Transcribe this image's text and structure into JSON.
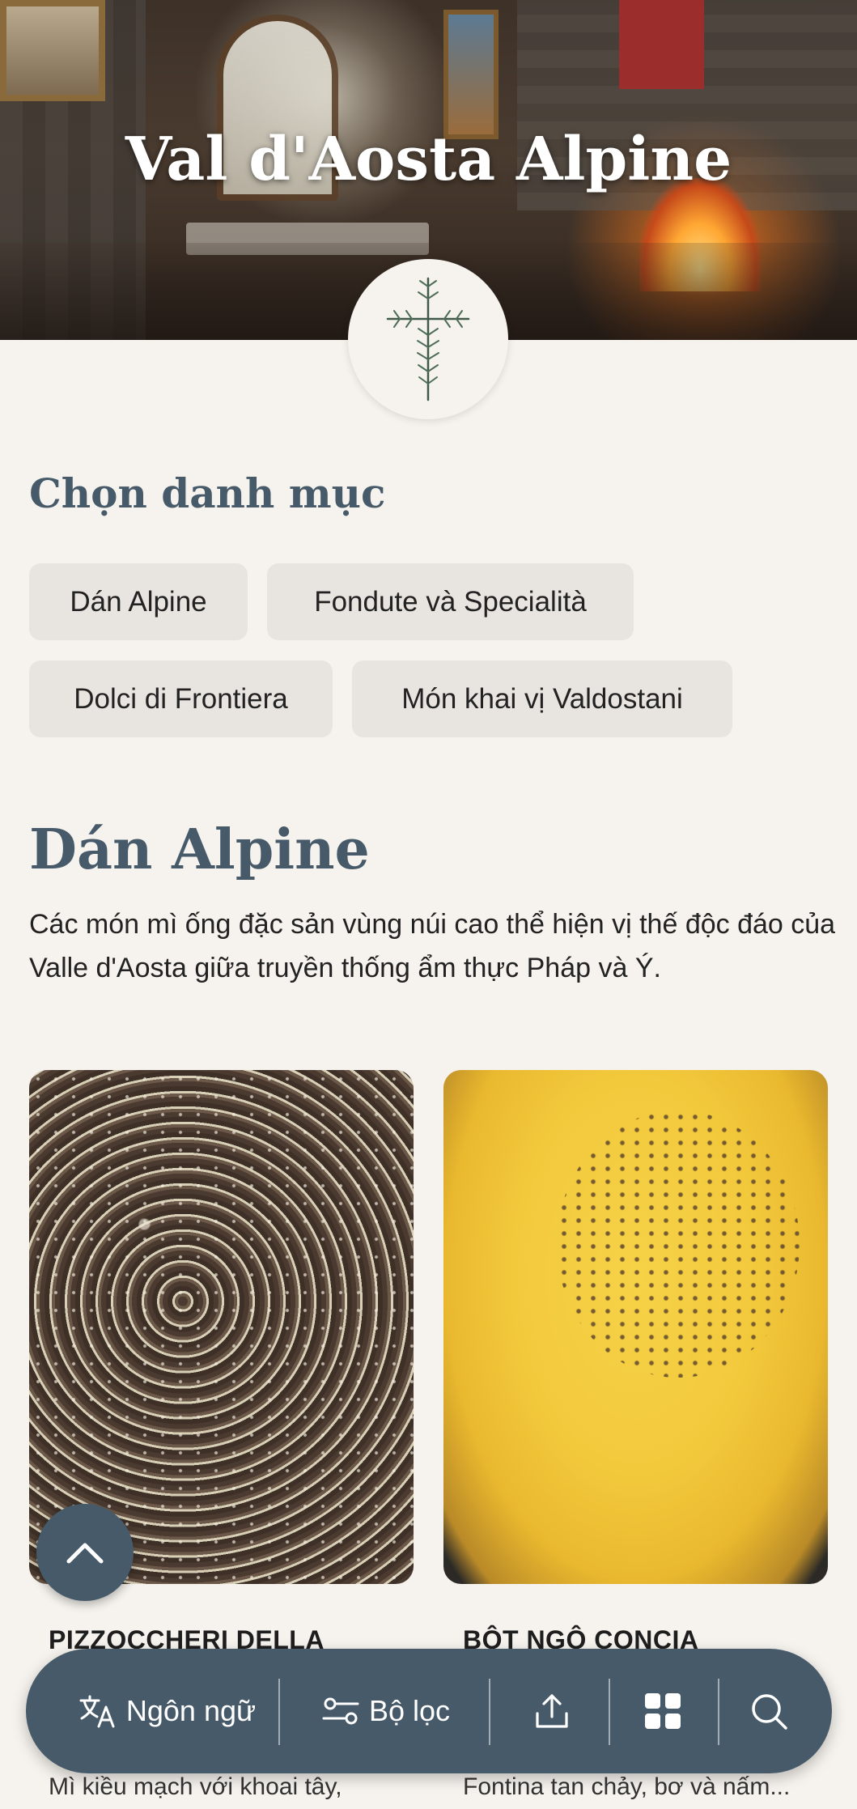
{
  "hero": {
    "title": "Val d'Aosta Alpine"
  },
  "categories_section": {
    "heading": "Chọn danh mục",
    "chips": [
      {
        "label": "Dán Alpine"
      },
      {
        "label": "Fondute và Specialità"
      },
      {
        "label": "Dolci di Frontiera"
      },
      {
        "label": "Món khai vị Valdostani"
      }
    ]
  },
  "category": {
    "title": "Dán Alpine",
    "description": "Các món mì ống đặc sản vùng núi cao thể hiện vị thế độc đáo của Valle d'Aosta giữa truyền thống ẩm thực Pháp và Ý."
  },
  "dishes": [
    {
      "name": "PIZZOCCHERI DELLA",
      "desc": "Mì kiều mạch với khoai tây,"
    },
    {
      "name": "BỘT NGÔ CONCIA",
      "desc": "Fontina tan chảy, bơ và nấm..."
    }
  ],
  "bottom_bar": {
    "language_label": "Ngôn ngữ",
    "filter_label": "Bộ lọc"
  },
  "colors": {
    "accent": "#475a69",
    "background": "#f6f3ee",
    "chip": "#e8e5e0"
  },
  "icons": [
    "logo-rosemary-cross-icon",
    "chevron-up-icon",
    "translate-icon",
    "filter-icon",
    "share-icon",
    "grid-icon",
    "search-icon"
  ]
}
